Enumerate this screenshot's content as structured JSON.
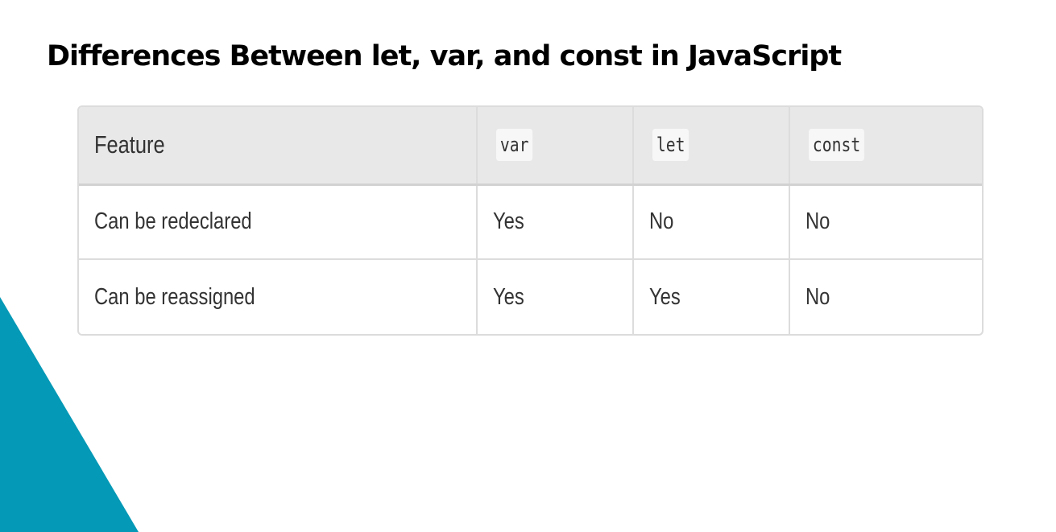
{
  "slide": {
    "title": "Differences Between let, var, and const in JavaScript"
  },
  "table": {
    "headers": [
      "Feature",
      "var",
      "let",
      "const"
    ],
    "rows": [
      [
        "Can be redeclared",
        "Yes",
        "No",
        "No"
      ],
      [
        "Can be reassigned",
        "Yes",
        "Yes",
        "No"
      ]
    ]
  },
  "colors": {
    "accent_triangle": "#0499b6",
    "header_background": "#e8e8e8",
    "border": "#dcdcdc"
  }
}
